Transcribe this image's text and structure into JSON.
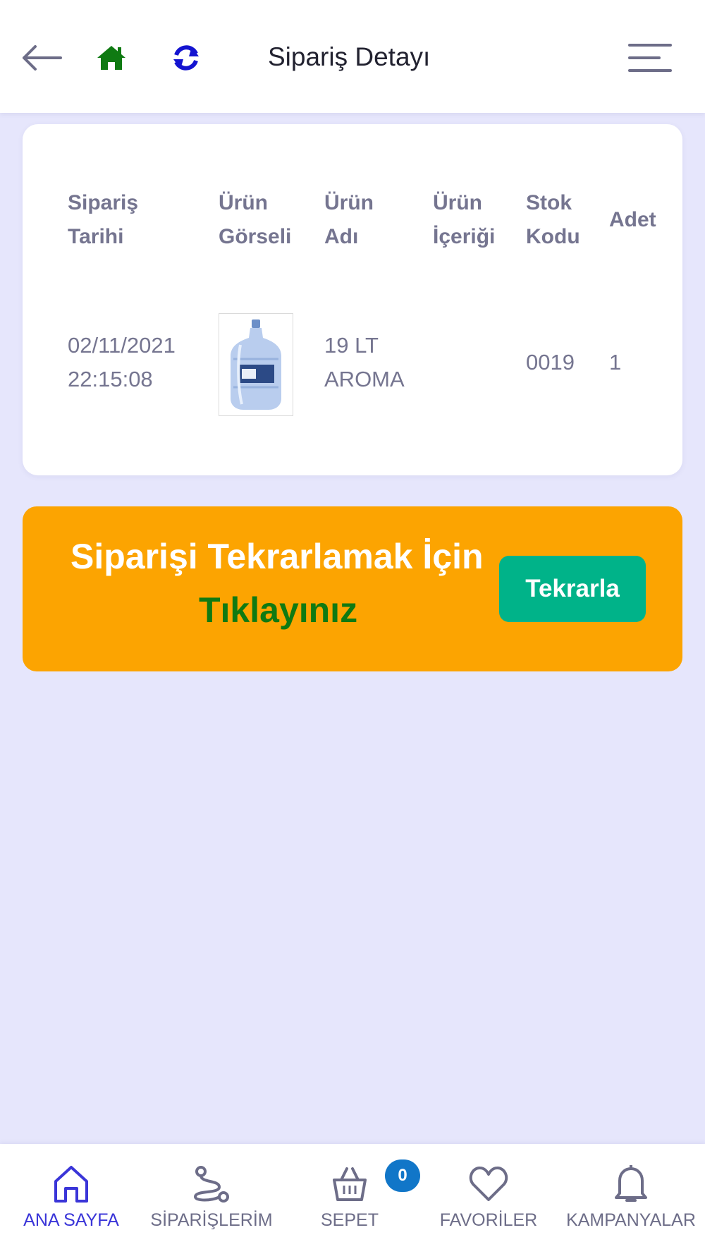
{
  "header": {
    "title": "Sipariş Detayı",
    "back_icon": "arrow-left-icon",
    "home_icon": "home-icon",
    "refresh_icon": "refresh-icon",
    "menu_icon": "menu-icon"
  },
  "table": {
    "columns": [
      {
        "line1": "Sipariş",
        "line2": "Tarihi"
      },
      {
        "line1": "Ürün",
        "line2": "Görseli"
      },
      {
        "line1": "Ürün",
        "line2": "Adı"
      },
      {
        "line1": "Ürün",
        "line2": "İçeriği"
      },
      {
        "line1": "Stok",
        "line2": "Kodu"
      },
      {
        "line1": "Adet",
        "line2": ""
      }
    ],
    "rows": [
      {
        "date_line1": "02/11/2021",
        "date_line2": "22:15:08",
        "image": "water-bottle-image",
        "name_line1": "19 LT",
        "name_line2": "AROMA",
        "content": "",
        "stock_code": "0019",
        "quantity": "1"
      }
    ]
  },
  "banner": {
    "line1": "Siparişi Tekrarlamak İçin",
    "line2": "Tıklayınız",
    "button_label": "Tekrarla"
  },
  "bottom_nav": {
    "items": [
      {
        "label": "ANA SAYFA",
        "icon": "home-outline-icon",
        "active": true
      },
      {
        "label": "SİPARİŞLERİM",
        "icon": "route-icon",
        "active": false
      },
      {
        "label": "SEPET",
        "icon": "basket-icon",
        "active": false
      },
      {
        "label": "FAVORİLER",
        "icon": "heart-icon",
        "active": false
      },
      {
        "label": "KAMPANYALAR",
        "icon": "bell-icon",
        "active": false
      }
    ],
    "cart_count": "0"
  },
  "colors": {
    "background": "#e6e6fc",
    "banner": "#fca401",
    "button": "#00b389",
    "accent_green": "#0f7a12",
    "nav_active": "#3a35d8",
    "badge": "#1176c8"
  }
}
